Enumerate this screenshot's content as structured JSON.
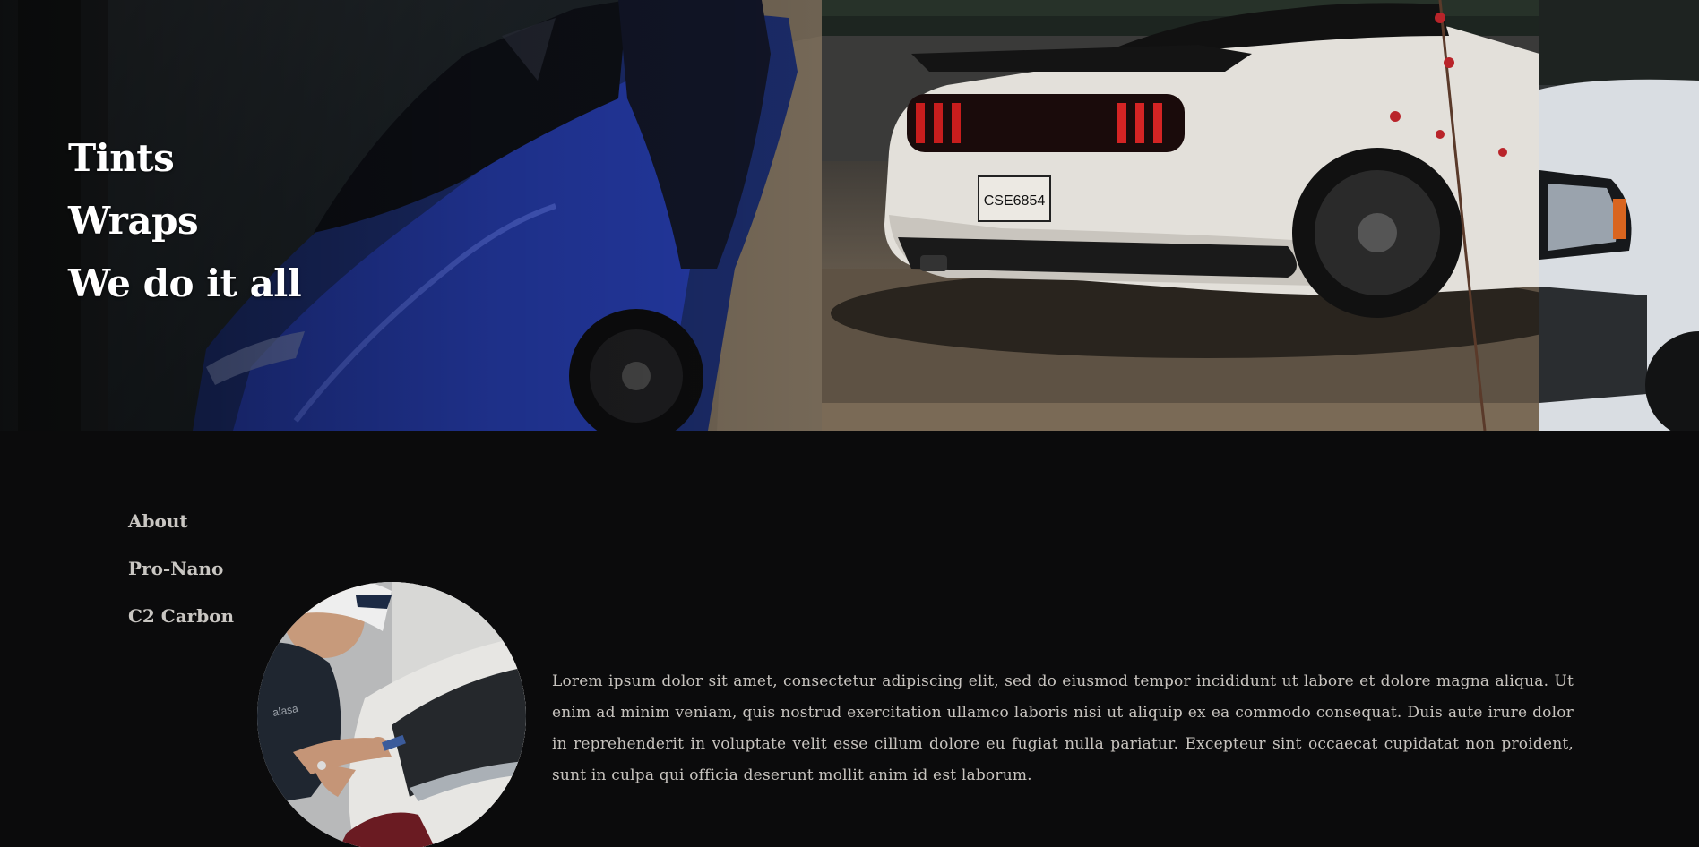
{
  "hero": {
    "lines": [
      "Tints",
      "Wraps",
      "We do it all"
    ],
    "images": {
      "left": "blue-sports-car-photo",
      "center": "white-mustang-rear-photo",
      "right": "white-truck-front-photo"
    },
    "plate_text": "CSE6854"
  },
  "nav": {
    "items": [
      {
        "label": "About"
      },
      {
        "label": "Pro-Nano"
      },
      {
        "label": "C2 Carbon"
      }
    ]
  },
  "about": {
    "image": "installer-applying-film-photo",
    "paragraph": "Lorem ipsum dolor sit amet, consectetur adipiscing elit, sed do eiusmod tempor incididunt ut labore et dolore magna aliqua. Ut enim ad minim veniam, quis nostrud exercitation ullamco laboris nisi ut aliquip ex ea commodo consequat. Duis aute irure dolor in reprehenderit in voluptate velit esse cillum dolore eu fugiat nulla pariatur. Excepteur sint occaecat cupidatat non proident, sunt in culpa qui officia deserunt mollit anim id est laborum."
  },
  "colors": {
    "background": "#0b0b0c",
    "hero_text": "#ffffff",
    "nav_text": "#c9c6c2",
    "body_text": "#c8c4bf"
  }
}
